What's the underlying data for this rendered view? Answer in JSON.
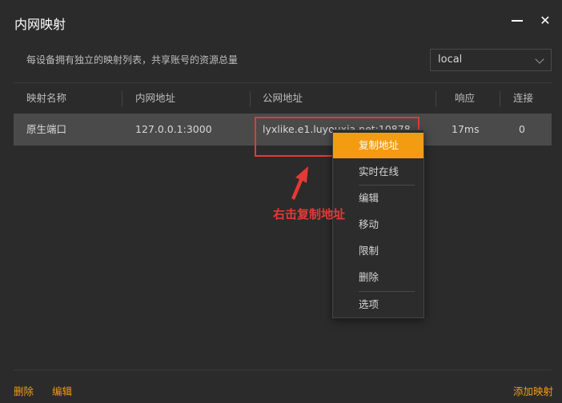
{
  "window": {
    "title": "内网映射",
    "minimize_label": "—",
    "close_label": "✕"
  },
  "description": "每设备拥有独立的映射列表，共享账号的资源总量",
  "selector": {
    "value": "local"
  },
  "table": {
    "headers": [
      "映射名称",
      "内网地址",
      "公网地址",
      "响应",
      "连接"
    ],
    "rows": [
      {
        "name": "原生端口",
        "internal": "127.0.0.1:3000",
        "public": "lyxlike.e1.luyouxia.net:10878",
        "latency": "17ms",
        "connections": "0"
      }
    ]
  },
  "context_menu": {
    "items": [
      "复制地址",
      "实时在线",
      "编辑",
      "移动",
      "限制",
      "删除",
      "选项"
    ],
    "active_index": 0
  },
  "annotation": {
    "text": "右击复制地址",
    "color": "#e53935"
  },
  "footer": {
    "delete_label": "删除",
    "edit_label": "编辑",
    "add_label": "添加映射"
  },
  "colors": {
    "accent": "#f39c12",
    "background": "#2b2b2b",
    "row_selected": "#4a4a4a"
  }
}
